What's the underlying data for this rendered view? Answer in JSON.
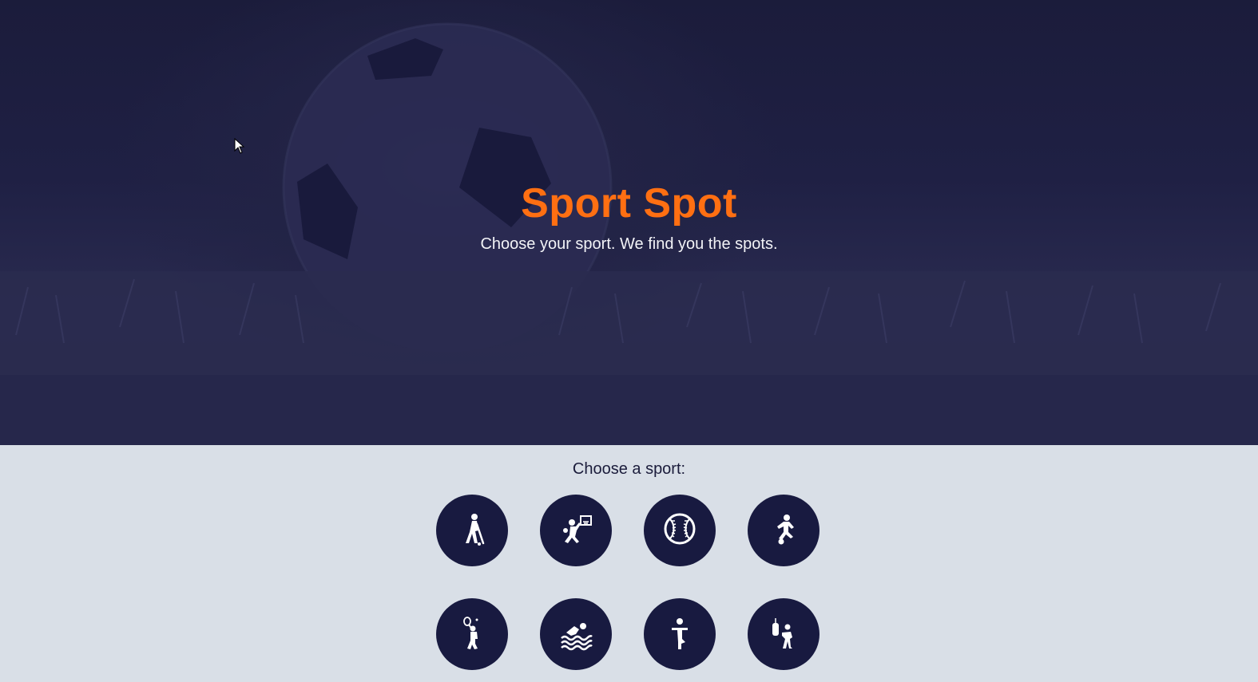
{
  "hero": {
    "title": "Sport Spot",
    "subtitle": "Choose your sport. We find you the spots.",
    "overlay_color": "#1c1d3e",
    "title_color": "#ff6f12"
  },
  "picker": {
    "label": "Choose a sport:",
    "button_color": "#181a40",
    "sports": [
      {
        "icon": "hockey-player-icon"
      },
      {
        "icon": "basketball-player-icon"
      },
      {
        "icon": "baseball-icon"
      },
      {
        "icon": "soccer-player-icon"
      },
      {
        "icon": "tennis-player-icon"
      },
      {
        "icon": "swimmer-icon"
      },
      {
        "icon": "gymnastics-icon"
      },
      {
        "icon": "boxing-icon"
      }
    ]
  }
}
